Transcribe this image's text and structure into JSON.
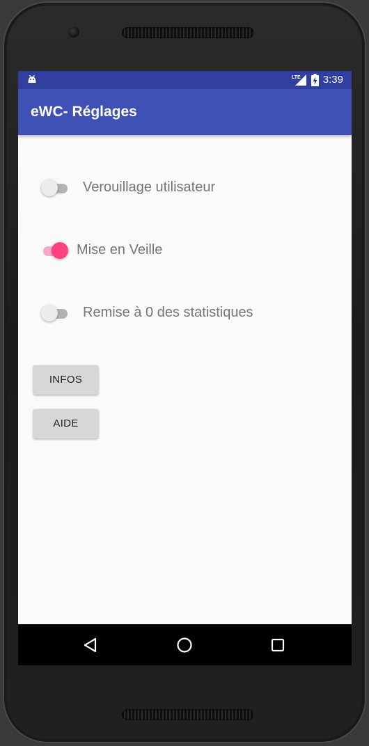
{
  "status_bar": {
    "time": "3:39",
    "network_label": "LTE",
    "icons": [
      "android-icon",
      "lte-signal-icon",
      "battery-charging-icon"
    ]
  },
  "app_bar": {
    "title": "eWC- Réglages"
  },
  "settings": [
    {
      "label": "Verouillage utilisateur",
      "checked": false
    },
    {
      "label": "Mise en Veille",
      "checked": true
    },
    {
      "label": "Remise à 0 des statistiques",
      "checked": false
    }
  ],
  "buttons": {
    "infos_label": "INFOS",
    "aide_label": "AIDE"
  },
  "nav_bar": {
    "icons": [
      "back-icon",
      "home-icon",
      "recents-icon"
    ]
  },
  "colors": {
    "primary": "#3f51b5",
    "primary_dark": "#303f9f",
    "accent": "#ff4081",
    "background": "#fafafa",
    "button": "#d6d7d7"
  }
}
